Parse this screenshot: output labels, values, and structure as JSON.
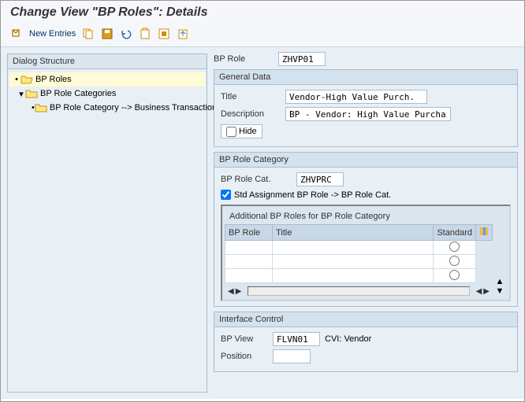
{
  "title": "Change View \"BP Roles\": Details",
  "toolbar": {
    "new_entries": "New Entries"
  },
  "tree": {
    "header": "Dialog Structure",
    "item1": "BP Roles",
    "item2": "BP Role Categories",
    "item3": "BP Role Category --> Business Transaction"
  },
  "bpRole": {
    "label": "BP Role",
    "value": "ZHVP01"
  },
  "general": {
    "title": "General Data",
    "titleLabel": "Title",
    "titleValue": "Vendor-High Value Purch.",
    "descLabel": "Description",
    "descValue": "BP - Vendor: High Value Purchases",
    "hideLabel": "Hide"
  },
  "roleCat": {
    "title": "BP Role Category",
    "catLabel": "BP Role Cat.",
    "catValue": "ZHVPRC",
    "stdLabel": "Std Assignment BP Role -> BP Role Cat.",
    "tableTitle": "Additional BP Roles for BP Role Category",
    "col1": "BP Role",
    "col2": "Title",
    "col3": "Standard"
  },
  "iface": {
    "title": "Interface Control",
    "viewLabel": "BP View",
    "viewValue": "FLVN01",
    "viewExtra": "CVI: Vendor",
    "posLabel": "Position",
    "posValue": ""
  }
}
